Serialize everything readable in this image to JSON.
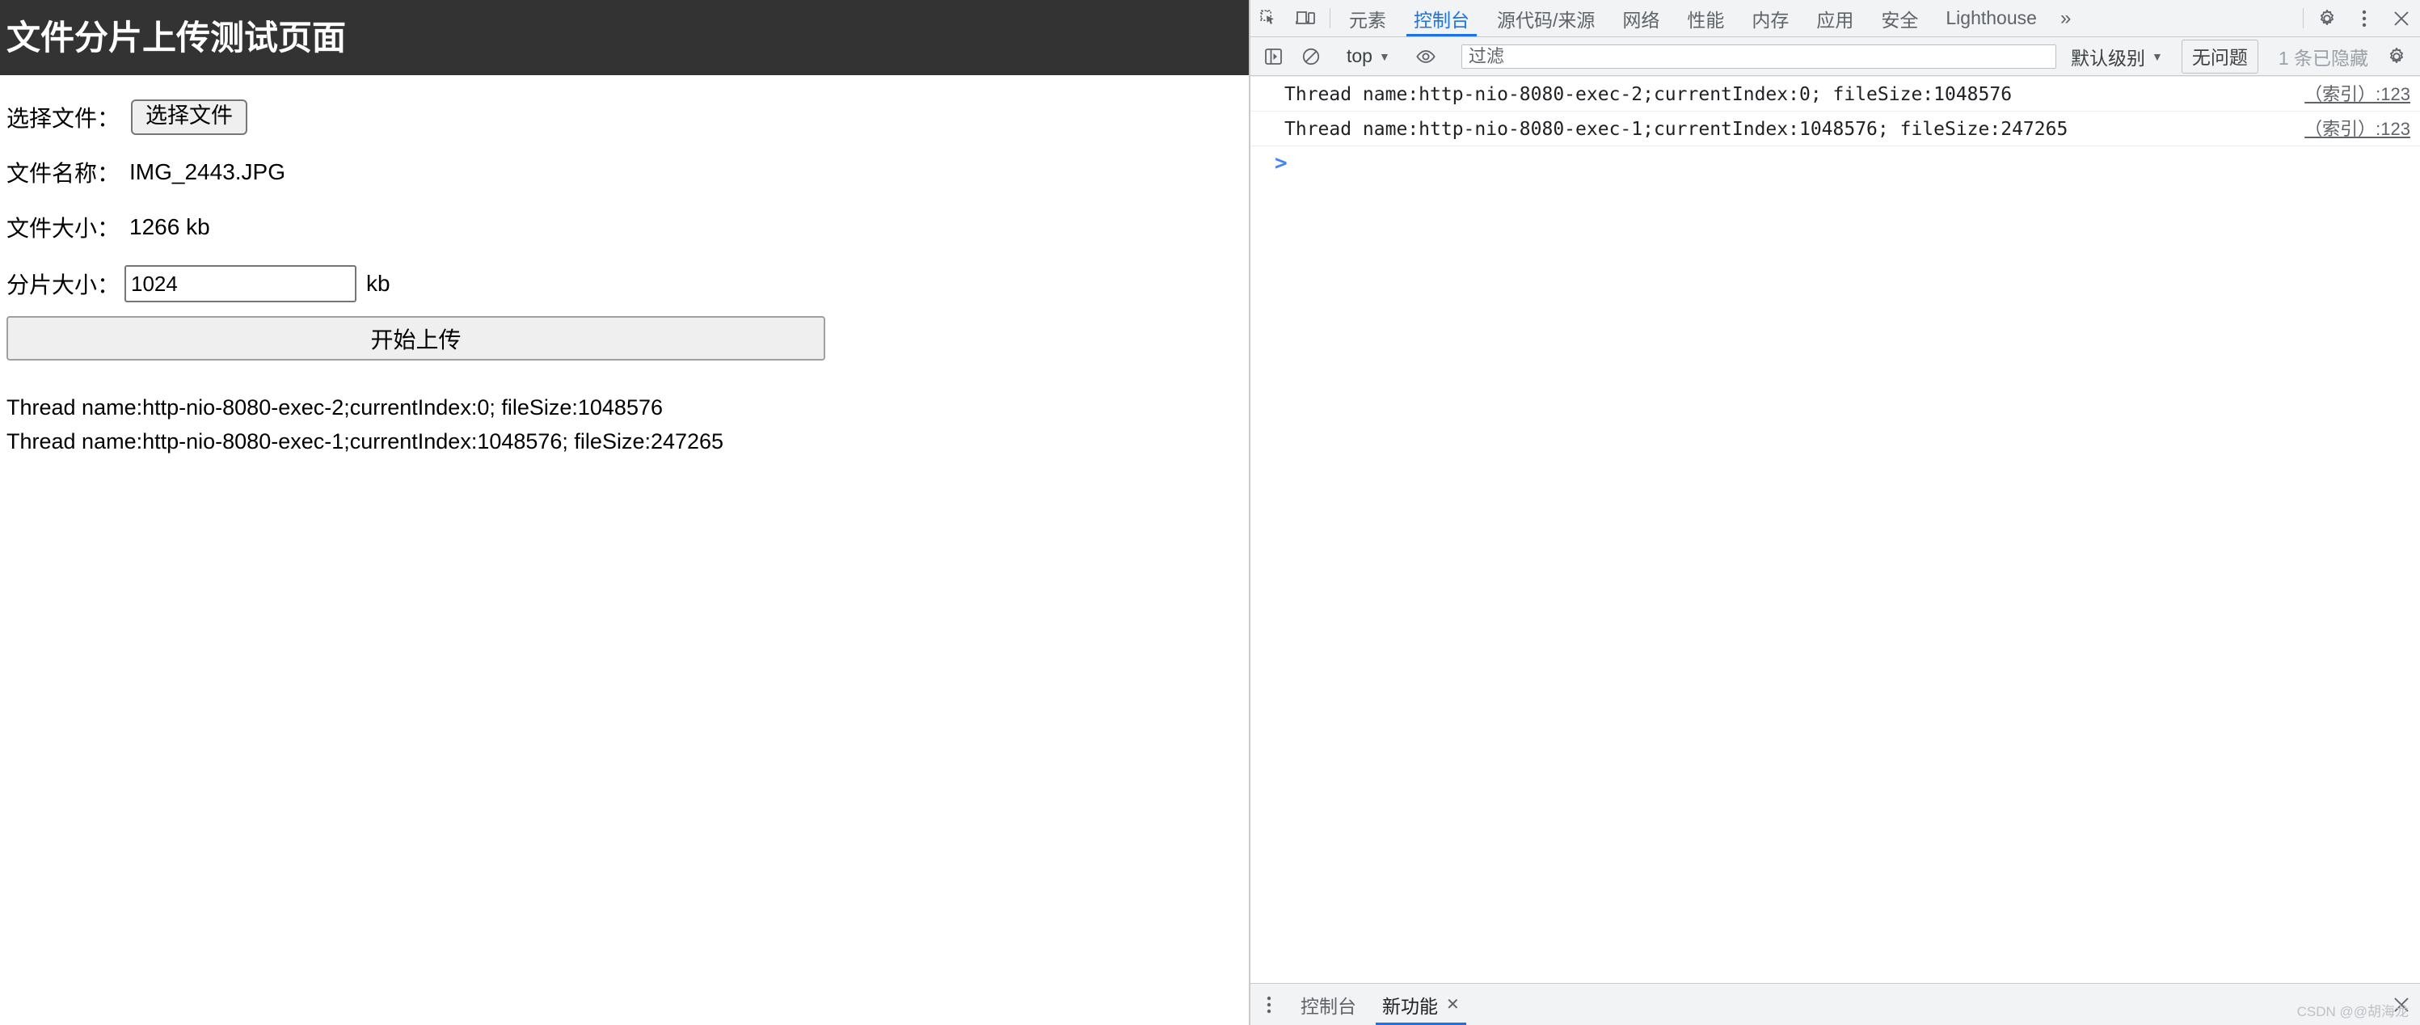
{
  "page": {
    "title": "文件分片上传测试页面",
    "header_bg": "#333333",
    "select_file_label": "选择文件：",
    "select_file_button": "选择文件",
    "file_name_label": "文件名称：",
    "file_name_value": "IMG_2443.JPG",
    "file_size_label": "文件大小：",
    "file_size_value": "1266 kb",
    "chunk_size_label": "分片大小：",
    "chunk_size_value": "1024",
    "chunk_size_unit": "kb",
    "upload_button": "开始上传",
    "results": [
      "Thread name:http-nio-8080-exec-2;currentIndex:0; fileSize:1048576",
      "Thread name:http-nio-8080-exec-1;currentIndex:1048576; fileSize:247265"
    ]
  },
  "devtools": {
    "accent_color": "#1a73e8",
    "tabs": [
      {
        "label": "元素",
        "active": false
      },
      {
        "label": "控制台",
        "active": true
      },
      {
        "label": "源代码/来源",
        "active": false
      },
      {
        "label": "网络",
        "active": false
      },
      {
        "label": "性能",
        "active": false
      },
      {
        "label": "内存",
        "active": false
      },
      {
        "label": "应用",
        "active": false
      },
      {
        "label": "安全",
        "active": false
      },
      {
        "label": "Lighthouse",
        "active": false
      }
    ],
    "more_tabs": "»",
    "console_toolbar": {
      "context": "top",
      "filter_placeholder": "过滤",
      "filter_value": "",
      "level": "默认级别",
      "issues": "无问题",
      "hidden_count": "1 条已隐藏"
    },
    "messages": [
      {
        "text": "Thread name:http-nio-8080-exec-2;currentIndex:0; fileSize:1048576",
        "source": "（索引）:123"
      },
      {
        "text": "Thread name:http-nio-8080-exec-1;currentIndex:1048576; fileSize:247265",
        "source": "（索引）:123"
      }
    ],
    "prompt": {
      "chevron": ">",
      "value": ""
    },
    "drawer": {
      "tabs": [
        {
          "label": "控制台",
          "active": false,
          "closable": false
        },
        {
          "label": "新功能",
          "active": true,
          "closable": true
        }
      ],
      "close_glyph": "✕"
    },
    "watermark": "CSDN @@胡海龙"
  }
}
